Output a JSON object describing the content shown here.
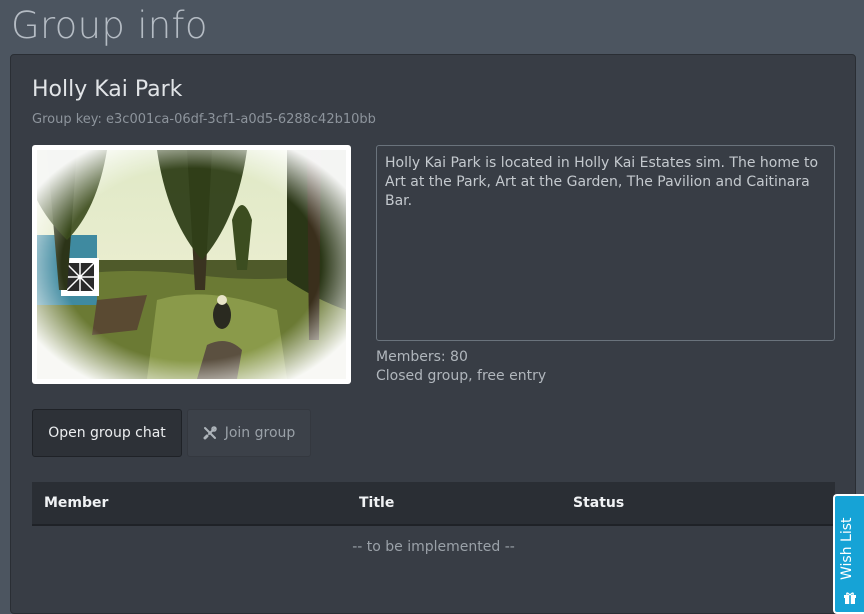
{
  "page": {
    "title": "Group info"
  },
  "group": {
    "name": "Holly Kai Park",
    "key_label": "Group key: e3c001ca-06df-3cf1-a0d5-6288c42b10bb",
    "description": "Holly Kai Park is located in Holly Kai Estates sim. The home to Art at the Park, Art at the Garden, The Pavilion and Caitinara Bar.",
    "members_label": "Members: 80",
    "type_label": "Closed group, free entry"
  },
  "actions": {
    "open_chat_label": "Open group chat",
    "join_label": "Join group",
    "join_icon": "tools-icon"
  },
  "table": {
    "columns": [
      "Member",
      "Title",
      "Status"
    ],
    "empty_text": "-- to be implemented --"
  },
  "wish_list": {
    "label": "Wish List",
    "icon": "gift-icon"
  },
  "colors": {
    "background": "#4c5560",
    "panel": "#383d45",
    "accent": "#16a3d6"
  }
}
